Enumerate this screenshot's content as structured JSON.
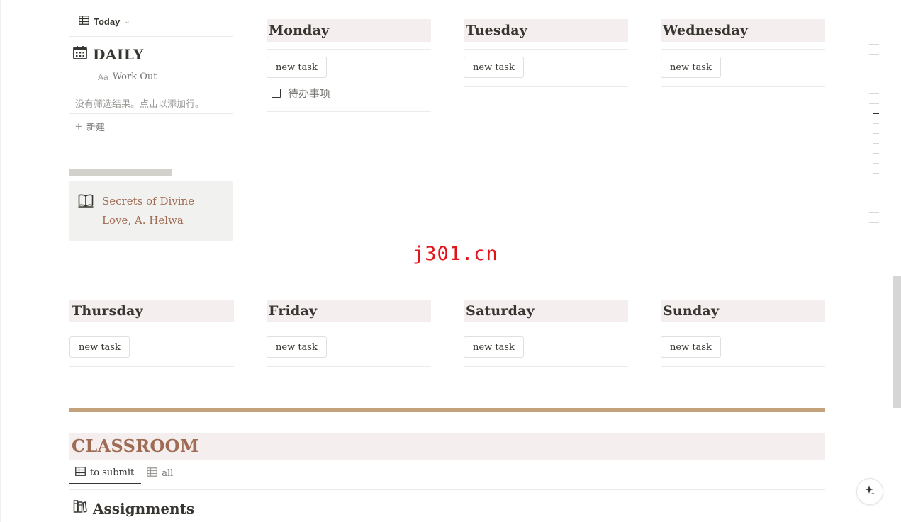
{
  "daily_view": {
    "tab_label": "Today",
    "title": "DAILY",
    "property_label": "Work Out",
    "empty_message": "没有筛选结果。点击以添加行。",
    "new_label": "新建"
  },
  "callout": {
    "text": "Secrets of Divine Love, A. Helwa"
  },
  "days": [
    {
      "name": "Monday",
      "button": "new task",
      "todo": "待办事项"
    },
    {
      "name": "Tuesday",
      "button": "new task"
    },
    {
      "name": "Wednesday",
      "button": "new task"
    },
    {
      "name": "Thursday",
      "button": "new task"
    },
    {
      "name": "Friday",
      "button": "new task"
    },
    {
      "name": "Saturday",
      "button": "new task"
    },
    {
      "name": "Sunday",
      "button": "new task"
    }
  ],
  "watermark": "j301.cn",
  "classroom": {
    "title": "CLASSROOM",
    "tabs": [
      "to submit",
      "all"
    ],
    "active_tab": "to submit",
    "section_title": "Assignments"
  },
  "colors": {
    "heading_bg": "#f4eeee",
    "accent_brown": "#9f6b53",
    "divider_tan": "#c4a27c",
    "watermark_red": "#e0151b"
  },
  "icons": [
    "table-icon",
    "calendar-icon",
    "text-property-icon",
    "plus-icon",
    "book-icon",
    "checkbox-icon",
    "assignments-icon",
    "ai-sparkle-icon"
  ]
}
